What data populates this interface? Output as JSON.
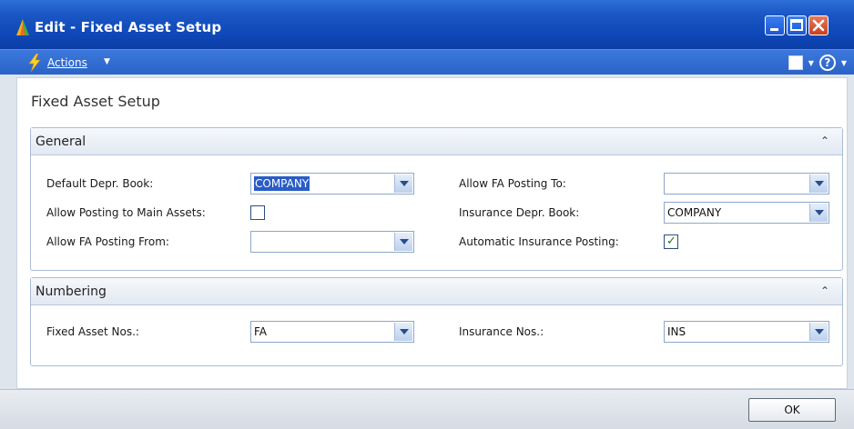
{
  "window": {
    "title": "Edit - Fixed Asset Setup",
    "icon": "nav-app-icon"
  },
  "actionbar": {
    "actions_label": "Actions",
    "actions_caret": "▼",
    "tool_caret": "▼",
    "help_label": "?"
  },
  "page": {
    "title": "Fixed Asset Setup"
  },
  "general": {
    "header": "General",
    "collapse_glyph": "⌃",
    "default_depr_book_label": "Default Depr. Book:",
    "default_depr_book_value": "COMPANY",
    "allow_posting_main_label": "Allow Posting to Main Assets:",
    "allow_posting_main_checked": false,
    "allow_fa_posting_from_label": "Allow FA Posting From:",
    "allow_fa_posting_from_value": "",
    "allow_fa_posting_to_label": "Allow FA Posting To:",
    "allow_fa_posting_to_value": "",
    "insurance_depr_book_label": "Insurance Depr. Book:",
    "insurance_depr_book_value": "COMPANY",
    "automatic_insurance_posting_label": "Automatic Insurance Posting:",
    "automatic_insurance_posting_checked": true
  },
  "numbering": {
    "header": "Numbering",
    "collapse_glyph": "⌃",
    "fixed_asset_nos_label": "Fixed Asset Nos.:",
    "fixed_asset_nos_value": "FA",
    "insurance_nos_label": "Insurance Nos.:",
    "insurance_nos_value": "INS"
  },
  "footer": {
    "ok_label": "OK"
  },
  "colors": {
    "titlebar": "#1a56c4",
    "actionbar": "#2a63c8",
    "selection": "#2a5cc6",
    "checkmark": "#1f7a1f"
  }
}
